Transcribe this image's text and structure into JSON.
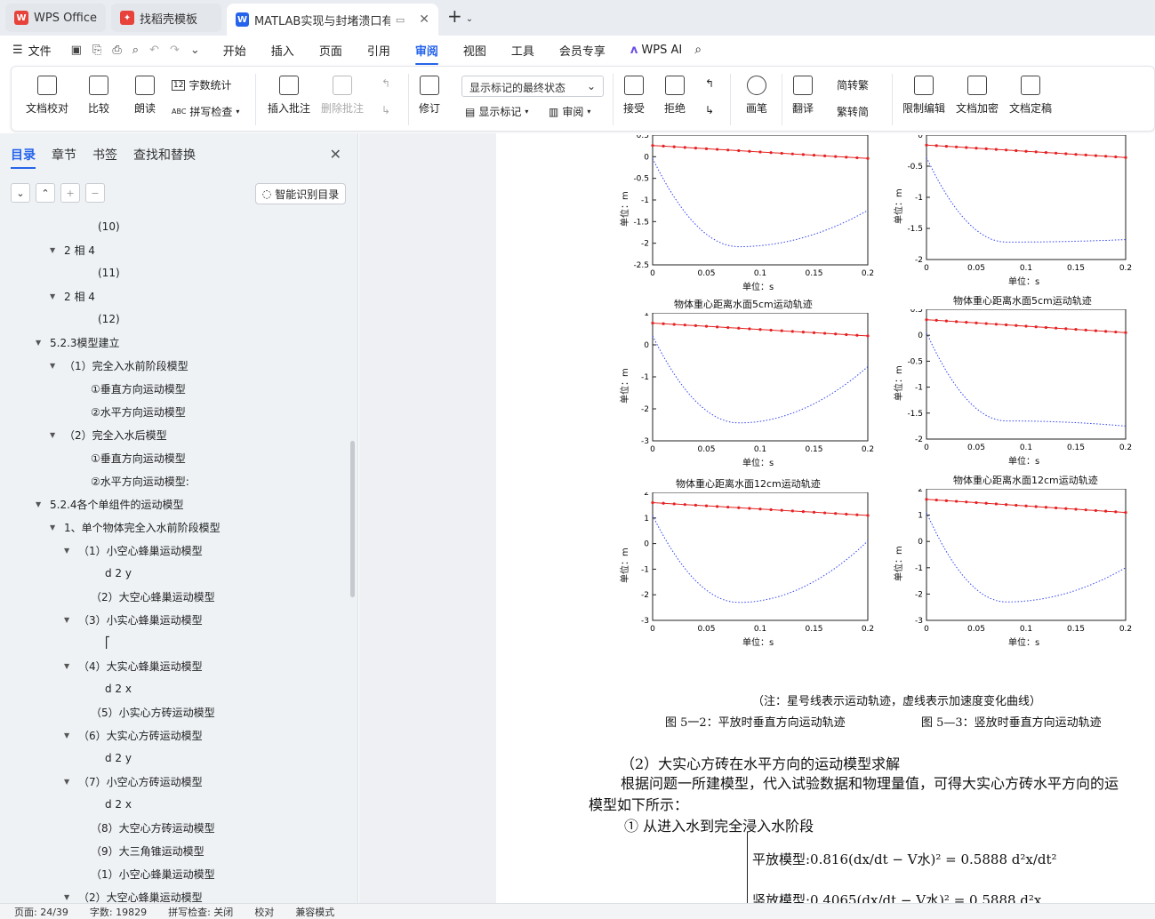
{
  "tabs": [
    {
      "label": "WPS Office",
      "active": false
    },
    {
      "label": "找稻壳模板",
      "active": false
    },
    {
      "label": "MATLAB实现与封堵溃口有关",
      "active": true
    }
  ],
  "menu": {
    "file": "文件",
    "items": [
      "开始",
      "插入",
      "页面",
      "引用",
      "审阅",
      "视图",
      "工具",
      "会员专享"
    ],
    "active": "审阅",
    "ai": "WPS AI"
  },
  "ribbon": {
    "proofread": "文档校对",
    "compare": "比较",
    "read_aloud": "朗读",
    "word_count": "字数统计",
    "spell_check": "拼写检查",
    "insert_comment": "插入批注",
    "delete_comment": "删除批注",
    "revise": "修订",
    "markup_state": "显示标记的最终状态",
    "show_markup": "显示标记",
    "review": "审阅",
    "accept": "接受",
    "reject": "拒绝",
    "pen": "画笔",
    "translate": "翻译",
    "to_traditional": "简转繁",
    "to_simplified": "繁转简",
    "restrict_edit": "限制编辑",
    "encrypt": "文档加密",
    "finalize": "文档定稿"
  },
  "nav": {
    "tabs": [
      "目录",
      "章节",
      "书签",
      "查找和替换"
    ],
    "smart_button": "智能识别目录",
    "toc": [
      {
        "text": "(10)",
        "indent": 110,
        "tri": ""
      },
      {
        "text": "2 相 4",
        "indent": 72,
        "tri": "▼"
      },
      {
        "text": "(11)",
        "indent": 110,
        "tri": ""
      },
      {
        "text": "2 相 4",
        "indent": 72,
        "tri": "▼"
      },
      {
        "text": "(12)",
        "indent": 110,
        "tri": ""
      },
      {
        "text": "5.2.3模型建立",
        "indent": 56,
        "tri": "▼"
      },
      {
        "text": "（1）完全入水前阶段模型",
        "indent": 72,
        "tri": "▼"
      },
      {
        "text": "①垂直方向运动模型",
        "indent": 102,
        "tri": ""
      },
      {
        "text": "②水平方向运动模型",
        "indent": 102,
        "tri": ""
      },
      {
        "text": "（2）完全入水后模型",
        "indent": 72,
        "tri": "▼"
      },
      {
        "text": "①垂直方向运动模型",
        "indent": 102,
        "tri": ""
      },
      {
        "text": "②水平方向运动模型:",
        "indent": 102,
        "tri": ""
      },
      {
        "text": "5.2.4各个单组件的运动模型",
        "indent": 56,
        "tri": "▼"
      },
      {
        "text": "1、单个物体完全入水前阶段模型",
        "indent": 72,
        "tri": "▼"
      },
      {
        "text": "（1）小空心蜂巢运动模型",
        "indent": 88,
        "tri": "▼"
      },
      {
        "text": "d 2 y",
        "indent": 118,
        "tri": ""
      },
      {
        "text": "（2）大空心蜂巢运动模型",
        "indent": 102,
        "tri": ""
      },
      {
        "text": "（3）小实心蜂巢运动模型",
        "indent": 88,
        "tri": "▼"
      },
      {
        "text": "⎡",
        "indent": 118,
        "tri": ""
      },
      {
        "text": "（4）大实心蜂巢运动模型",
        "indent": 88,
        "tri": "▼"
      },
      {
        "text": "d 2 x",
        "indent": 118,
        "tri": ""
      },
      {
        "text": "（5）小实心方砖运动模型",
        "indent": 102,
        "tri": ""
      },
      {
        "text": "（6）大实心方砖运动模型",
        "indent": 88,
        "tri": "▼"
      },
      {
        "text": "d 2 y",
        "indent": 118,
        "tri": ""
      },
      {
        "text": "（7）小空心方砖运动模型",
        "indent": 88,
        "tri": "▼"
      },
      {
        "text": "d 2 x",
        "indent": 118,
        "tri": ""
      },
      {
        "text": "（8）大空心方砖运动模型",
        "indent": 102,
        "tri": ""
      },
      {
        "text": "（9）大三角锥运动模型",
        "indent": 102,
        "tri": ""
      },
      {
        "text": "（1）小空心蜂巢运动模型",
        "indent": 102,
        "tri": ""
      },
      {
        "text": "（2）大空心蜂巢运动模型",
        "indent": 88,
        "tri": "▼"
      }
    ]
  },
  "plots": [
    {
      "title": "",
      "ylabel": "单位：m",
      "xlabel": "单位：s",
      "yticks": [
        "0.5",
        "0",
        "-0.5",
        "-1",
        "-1.5",
        "-2",
        "-2.5"
      ],
      "xticks": [
        "0",
        "0.05",
        "0.1",
        "0.15",
        "0.2"
      ]
    },
    {
      "title": "",
      "ylabel": "单位：m",
      "xlabel": "单位：s",
      "yticks": [
        "0",
        "-0.5",
        "-1",
        "-1.5",
        "-2"
      ],
      "xticks": [
        "0",
        "0.05",
        "0.1",
        "0.15",
        "0.2"
      ]
    },
    {
      "title": "物体重心距离水面5cm运动轨迹",
      "ylabel": "单位：m",
      "xlabel": "单位：s",
      "yticks": [
        "1",
        "0",
        "-1",
        "-2",
        "-3"
      ],
      "xticks": [
        "0",
        "0.05",
        "0.1",
        "0.15",
        "0.2"
      ]
    },
    {
      "title": "物体重心距离水面5cm运动轨迹",
      "ylabel": "单位：m",
      "xlabel": "单位：s",
      "yticks": [
        "0.5",
        "0",
        "-0.5",
        "-1",
        "-1.5",
        "-2"
      ],
      "xticks": [
        "0",
        "0.05",
        "0.1",
        "0.15",
        "0.2"
      ]
    },
    {
      "title": "物体重心距离水面12cm运动轨迹",
      "ylabel": "单位：m",
      "xlabel": "单位：s",
      "yticks": [
        "2",
        "1",
        "0",
        "-1",
        "-2",
        "-3"
      ],
      "xticks": [
        "0",
        "0.05",
        "0.1",
        "0.15",
        "0.2"
      ]
    },
    {
      "title": "物体重心距离水面12cm运动轨迹",
      "ylabel": "单位：m",
      "xlabel": "单位：s",
      "yticks": [
        "2",
        "1",
        "0",
        "-1",
        "-2",
        "-3"
      ],
      "xticks": [
        "0",
        "0.05",
        "0.1",
        "0.15",
        "0.2"
      ]
    }
  ],
  "document": {
    "note": "（注：星号线表示运动轨迹，虚线表示加速度变化曲线）",
    "fig_left": "图 5一2：平放时垂直方向运动轨迹",
    "fig_right": "图 5—3：竖放时垂直方向运动轨迹",
    "para1": "（2）大实心方砖在水平方向的运动模型求解",
    "para2": "根据问题一所建模型，代入试验数据和物理量值，可得大实心方砖水平方向的运",
    "para3": "模型如下所示：",
    "para4": "①  从进入水到完全浸入水阶段",
    "eq1": "平放模型:0.816(dx/dt − V水)² = 0.5888 d²x/dt²",
    "eq2": "竖放模型:0.4065(dx/dt − V水)² = 0.5888 d²x"
  },
  "status": {
    "page": "页面: 24/39",
    "words": "字数: 19829",
    "spell": "拼写检查: 关闭",
    "proof": "校对",
    "compat": "兼容模式"
  }
}
